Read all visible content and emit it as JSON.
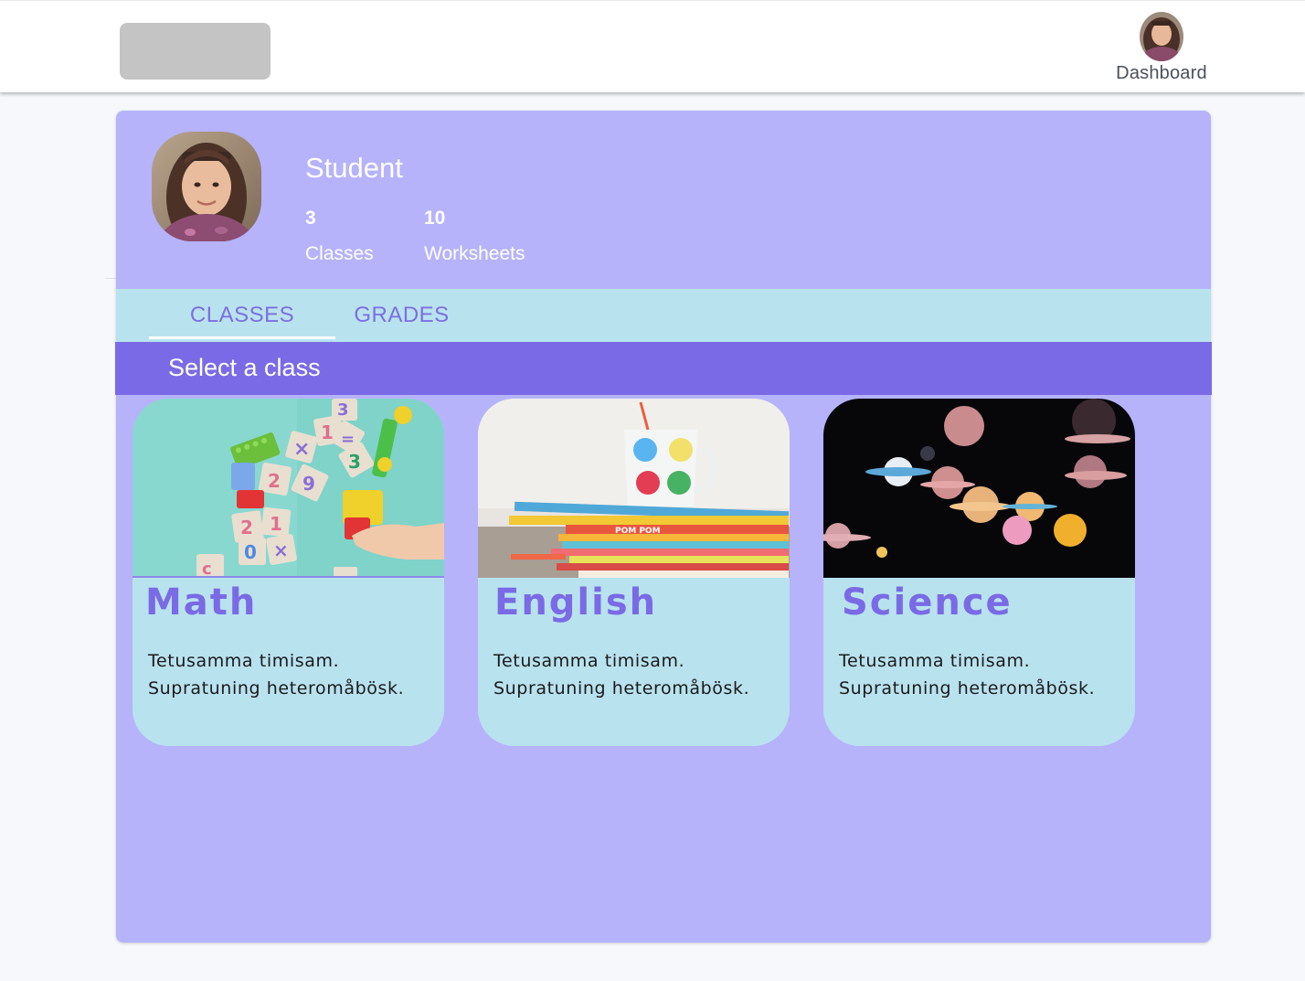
{
  "header": {
    "dashboard_label": "Dashboard",
    "logo_icon": "logo-placeholder",
    "avatar_icon": "user-avatar"
  },
  "profile": {
    "role": "Student",
    "stats": [
      {
        "value": "3",
        "label": "Classes"
      },
      {
        "value": "10",
        "label": "Worksheets"
      }
    ]
  },
  "tabs": [
    {
      "label": "CLASSES",
      "active": true
    },
    {
      "label": "GRADES",
      "active": false
    }
  ],
  "class_section": {
    "title": "Select a class"
  },
  "classes": [
    {
      "name": "Math",
      "line1": "Tetusamma timisam.",
      "line2": "Supratuning heteromåbösk.",
      "image": "number-blocks-photo"
    },
    {
      "name": "English",
      "line1": "Tetusamma timisam.",
      "line2": "Supratuning heteromåbösk.",
      "image": "books-and-mug-photo"
    },
    {
      "name": "Science",
      "line1": "Tetusamma timisam.",
      "line2": "Supratuning heteromåbösk.",
      "image": "planets-photo"
    }
  ],
  "colors": {
    "panel": "#b6b3fb",
    "accent": "#7a6ae5",
    "tab_bar": "#b9e2ef",
    "card": "#b9e2ef"
  }
}
